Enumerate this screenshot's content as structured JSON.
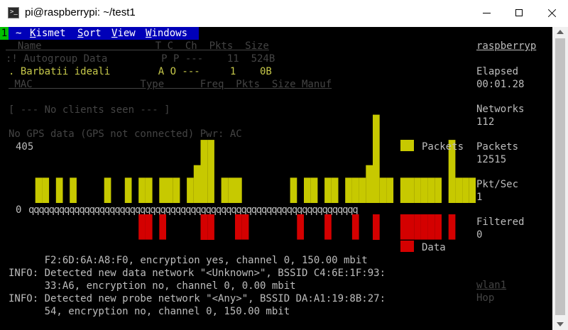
{
  "window": {
    "title": "pi@raspberrypi: ~/test1"
  },
  "menu": {
    "number": "1",
    "items": [
      {
        "label": "~"
      },
      {
        "label": "Kismet",
        "accel": "K",
        "rest": "ismet"
      },
      {
        "label": "Sort",
        "accel": "S",
        "rest": "ort"
      },
      {
        "label": "View",
        "accel": "V",
        "rest": "iew"
      },
      {
        "label": "Windows",
        "accel": "W",
        "rest": "indows"
      }
    ]
  },
  "network_list": {
    "header": "  Name                   T C  Ch  Pkts  Size",
    "rows": [
      ":! Autogroup Data         P P ---    11  524B",
      ". Barbatii ideali        A O ---     1    0B"
    ]
  },
  "client_list": {
    "header": " MAC                  Type      Freq  Pkts  Size Manuf",
    "empty": "[ --- No clients seen --- ]"
  },
  "gps_status": "No GPS data (GPS not connected) Pwr: AC",
  "packet_graph": {
    "max_label": "405",
    "zero_label": "0",
    "baseline_text": "qqqqqqqqqqqqqqqqqqqqqqqqqqqqqqqqqqqqqqqqqqqqqqqqqqqqqqqqqqqqqqqqq",
    "legend_packets": "Packets",
    "legend_data": "Data",
    "packet_color": "#c7c900",
    "data_color": "#d40000"
  },
  "chart_data": {
    "type": "bar",
    "title": "",
    "ylim": [
      0,
      405
    ],
    "series": [
      {
        "name": "Packets",
        "values": [
          0,
          80,
          80,
          0,
          80,
          0,
          80,
          0,
          0,
          0,
          0,
          80,
          0,
          0,
          80,
          0,
          80,
          80,
          0,
          80,
          80,
          80,
          0,
          80,
          120,
          200,
          200,
          0,
          80,
          80,
          80,
          0,
          0,
          0,
          0,
          0,
          0,
          0,
          80,
          0,
          80,
          80,
          0,
          80,
          80,
          0,
          80,
          80,
          80,
          120,
          280,
          80,
          80,
          0,
          80,
          80,
          80,
          80,
          80,
          80,
          0,
          200,
          80,
          80,
          80,
          80,
          80,
          80
        ]
      },
      {
        "name": "Data",
        "values": [
          0,
          0,
          0,
          0,
          0,
          0,
          0,
          0,
          0,
          0,
          0,
          0,
          0,
          0,
          0,
          0,
          80,
          80,
          0,
          80,
          0,
          0,
          0,
          0,
          0,
          120,
          200,
          0,
          0,
          0,
          80,
          80,
          0,
          0,
          0,
          0,
          0,
          0,
          0,
          80,
          0,
          0,
          0,
          80,
          0,
          0,
          0,
          80,
          0,
          0,
          120,
          0,
          0,
          0,
          80,
          80,
          80,
          80,
          80,
          80,
          0,
          80,
          0,
          0,
          0,
          80,
          80,
          0
        ]
      }
    ]
  },
  "sidebar": {
    "host": "raspberryp",
    "stats": [
      {
        "label": "Elapsed",
        "value": "00:01.28"
      },
      {
        "label": "Networks",
        "value": "112"
      },
      {
        "label": "Packets",
        "value": "12515"
      },
      {
        "label": "Pkt/Sec",
        "value": "1"
      },
      {
        "label": "Filtered",
        "value": "0"
      }
    ],
    "interface": "wlan1",
    "channel": "Hop"
  },
  "log": [
    "      F2:6D:6A:A8:F0, encryption yes, channel 0, 150.00 mbit",
    "INFO: Detected new data network \"<Unknown>\", BSSID C4:6E:1F:93:",
    "      33:A6, encryption no, channel 0, 0.00 mbit",
    "INFO: Detected new probe network \"<Any>\", BSSID DA:A1:19:8B:27:",
    "      54, encryption no, channel 0, 150.00 mbit"
  ]
}
